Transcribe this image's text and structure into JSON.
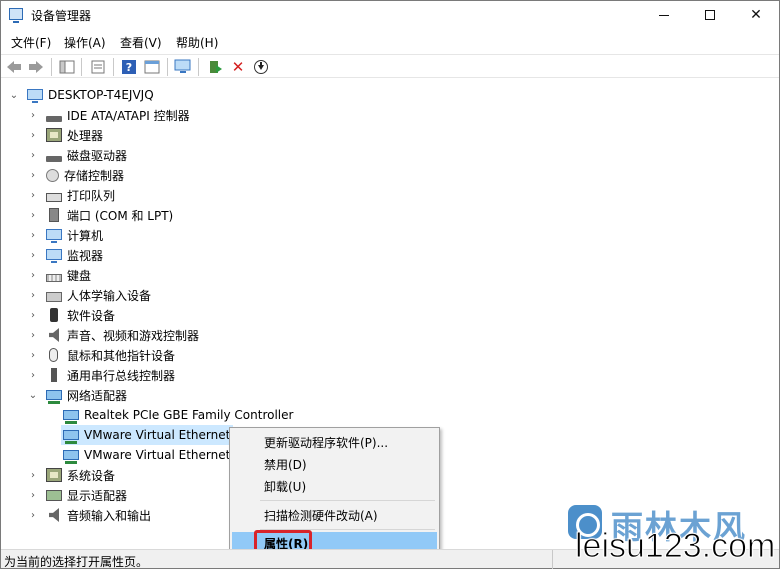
{
  "window": {
    "title": "设备管理器"
  },
  "menu": {
    "file": "文件(F)",
    "action": "操作(A)",
    "view": "查看(V)",
    "help": "帮助(H)"
  },
  "tree": {
    "root": "DESKTOP-T4EJVJQ",
    "items": [
      "IDE ATA/ATAPI 控制器",
      "处理器",
      "磁盘驱动器",
      "存储控制器",
      "打印队列",
      "端口 (COM 和 LPT)",
      "计算机",
      "监视器",
      "键盘",
      "人体学输入设备",
      "软件设备",
      "声音、视频和游戏控制器",
      "鼠标和其他指针设备",
      "通用串行总线控制器",
      "网络适配器"
    ],
    "network_children": [
      "Realtek PCIe GBE Family Controller",
      "VMware Virtual Ethernet",
      "VMware Virtual Ethernet"
    ],
    "after_items": [
      "系统设备",
      "显示适配器",
      "音频输入和输出"
    ]
  },
  "context_menu": {
    "update": "更新驱动程序软件(P)...",
    "disable": "禁用(D)",
    "uninstall": "卸载(U)",
    "scan": "扫描检测硬件改动(A)",
    "properties": "属性(R)"
  },
  "status": {
    "text": "为当前的选择打开属性页。"
  },
  "watermark": {
    "cn": "雨林木风",
    "en": "leisu123.com"
  },
  "colors": {
    "selection": "#cce8ff",
    "hover": "#91c9f7",
    "highlight_box": "#d8232a",
    "accent": "#2d7cc1"
  }
}
